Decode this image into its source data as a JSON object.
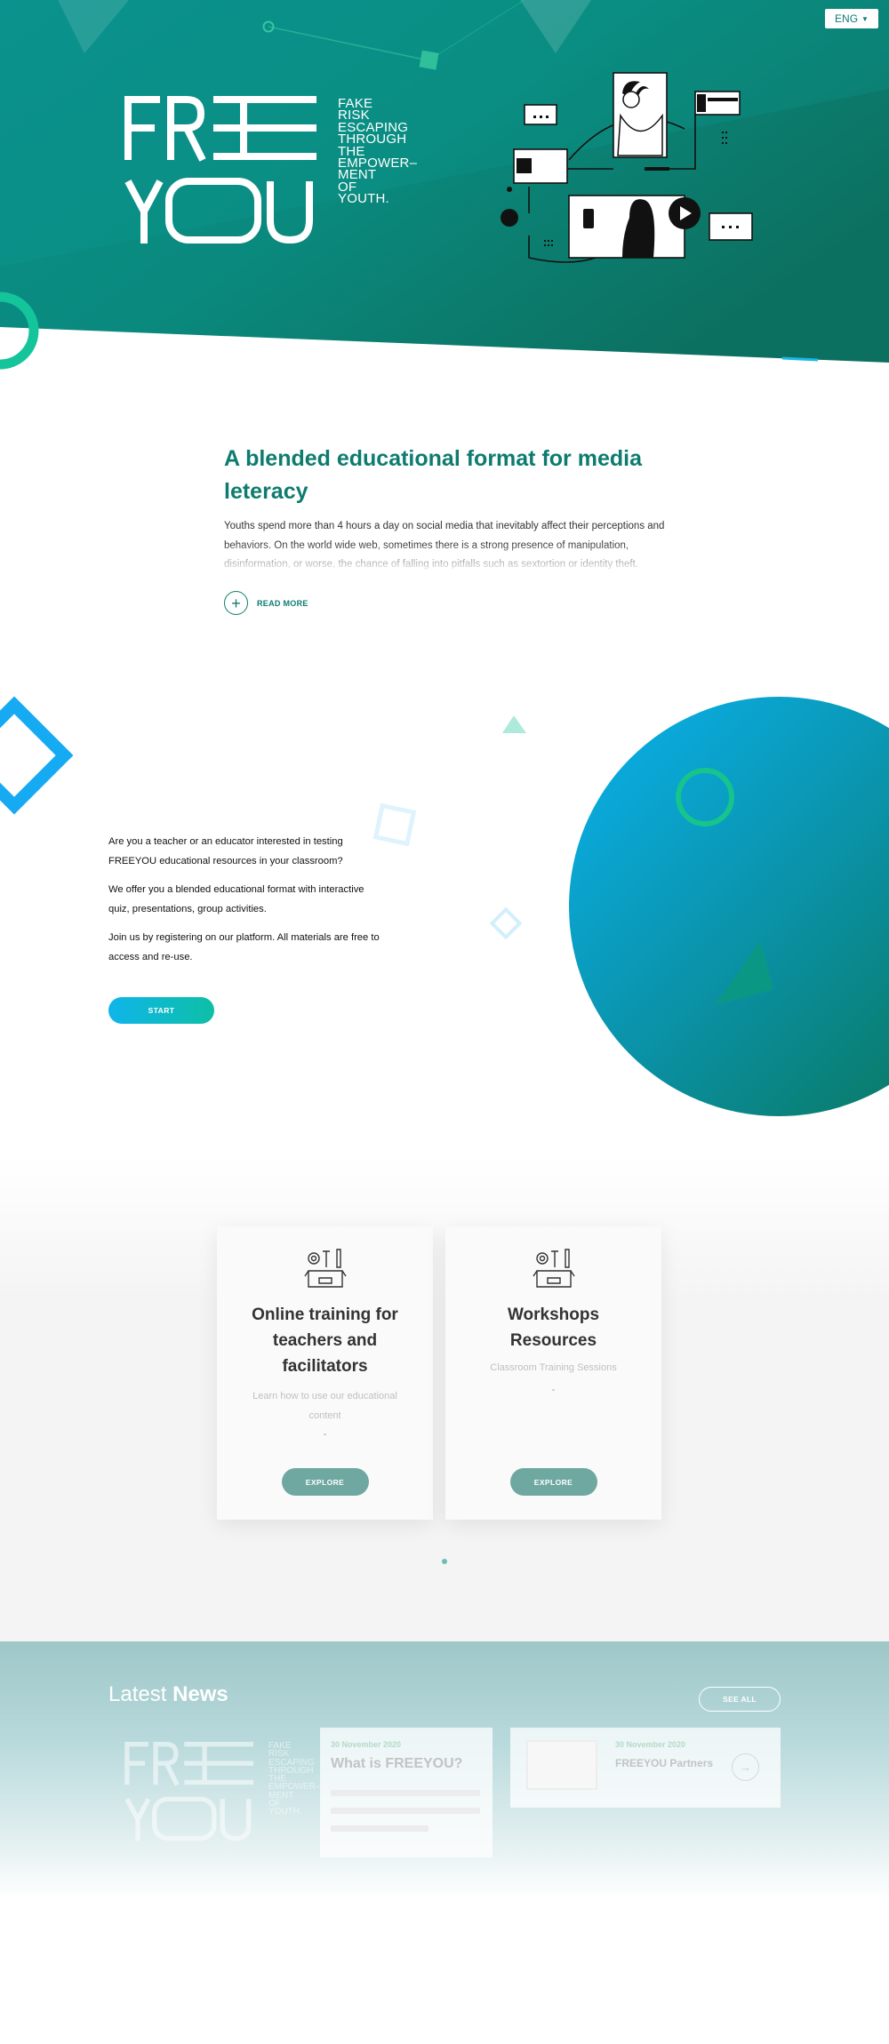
{
  "header": {
    "language": "ENG",
    "logo_text": "FREE YOU",
    "tagline": [
      "FAKE",
      "RISK",
      "ESCAPING",
      "THROUGH",
      "THE",
      "EMPOWER–",
      "MENT",
      "OF",
      "YOUTH."
    ]
  },
  "intro": {
    "title": "A blended educational format for media leteracy",
    "body": "Youths spend more than 4 hours a day on social media that inevitably affect their perceptions and behaviors. On the world wide web, sometimes there is a strong presence of manipulation, disinformation, or worse, the chance of falling into pitfalls such as sextortion or identity theft.",
    "read_more": "READ MORE"
  },
  "start": {
    "paragraphs": [
      "Are you a teacher or an educator interested in testing FREEYOU educational resources in your classroom?",
      "We offer you a blended educational format with interactive quiz, presentations, group activities.",
      "Join us by registering on our platform. All materials are free to access and re-use."
    ],
    "button": "START"
  },
  "cards": [
    {
      "title": "Online training for teachers and facilitators",
      "subtitle": "Learn how to use our educational content",
      "dash": "-",
      "button": "EXPLORE",
      "icon": "tools-box-icon"
    },
    {
      "title": "Workshops Resources",
      "subtitle": "Classroom Training Sessions",
      "dash": "-",
      "button": "EXPLORE",
      "icon": "tools-box-icon"
    }
  ],
  "news": {
    "title_light": "Latest",
    "title_bold": "News",
    "see_all": "SEE ALL",
    "items": [
      {
        "date": "30 November 2020",
        "title": "What is FREEYOU?"
      },
      {
        "date": "30 November 2020",
        "title": "FREEYOU Partners"
      }
    ]
  },
  "colors": {
    "primary": "#0d7c6f",
    "accent_blue": "#0fb5ea",
    "accent_green": "#14c49a"
  }
}
